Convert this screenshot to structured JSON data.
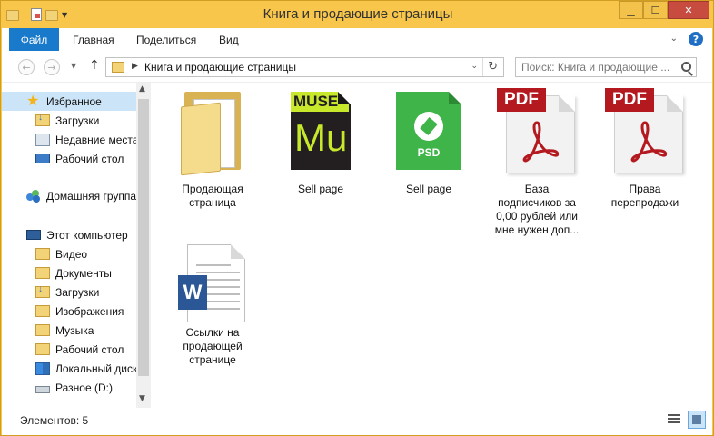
{
  "window": {
    "title": "Книга и продающие страницы",
    "controls": {
      "minimize": "▁",
      "maximize": "☐",
      "close": "✕"
    }
  },
  "ribbon": {
    "file_tab": "Файл",
    "tabs": [
      "Главная",
      "Поделиться",
      "Вид"
    ],
    "help": "?"
  },
  "address": {
    "path": "Книга и продающие страницы",
    "search_placeholder": "Поиск: Книга и продающие ..."
  },
  "navigation": {
    "items": [
      {
        "label": "Избранное",
        "icon": "star-icon",
        "selected": true
      },
      {
        "label": "Загрузки",
        "icon": "downloads-folder-icon"
      },
      {
        "label": "Недавние места",
        "icon": "recent-places-icon"
      },
      {
        "label": "Рабочий стол",
        "icon": "desktop-icon"
      },
      {
        "label": "Домашняя группа",
        "icon": "homegroup-icon"
      },
      {
        "label": "Этот компьютер",
        "icon": "computer-icon"
      },
      {
        "label": "Видео",
        "icon": "videos-folder-icon"
      },
      {
        "label": "Документы",
        "icon": "documents-folder-icon"
      },
      {
        "label": "Загрузки",
        "icon": "downloads-folder-icon"
      },
      {
        "label": "Изображения",
        "icon": "pictures-folder-icon"
      },
      {
        "label": "Музыка",
        "icon": "music-folder-icon"
      },
      {
        "label": "Рабочий стол",
        "icon": "desktop-folder-icon"
      },
      {
        "label": "Локальный диск",
        "icon": "local-disk-icon"
      },
      {
        "label": "Разное (D:)",
        "icon": "drive-icon"
      }
    ]
  },
  "files": [
    {
      "label": "Продающая\nстраница",
      "type": "folder"
    },
    {
      "label": "Sell page",
      "type": "muse",
      "badge": "MUSE",
      "mark": "Mu"
    },
    {
      "label": "Sell page",
      "type": "psd",
      "badge": "PSD"
    },
    {
      "label": "База\nподписчиков за\n0,00 рублей или\nмне нужен доп...",
      "type": "pdf",
      "badge": "PDF"
    },
    {
      "label": "Права\nперепродажи",
      "type": "pdf",
      "badge": "PDF"
    },
    {
      "label": "Ссылки на\nпродающей\nстранице",
      "type": "word",
      "badge": "W"
    }
  ],
  "status": {
    "count": "Элементов: 5"
  },
  "colors": {
    "frame": "#f7c64a",
    "file_tab": "#1979ca",
    "muse_accent": "#c7e82b",
    "psd_green": "#3fb549",
    "pdf_red": "#b3191f",
    "word_blue": "#2b5797"
  }
}
